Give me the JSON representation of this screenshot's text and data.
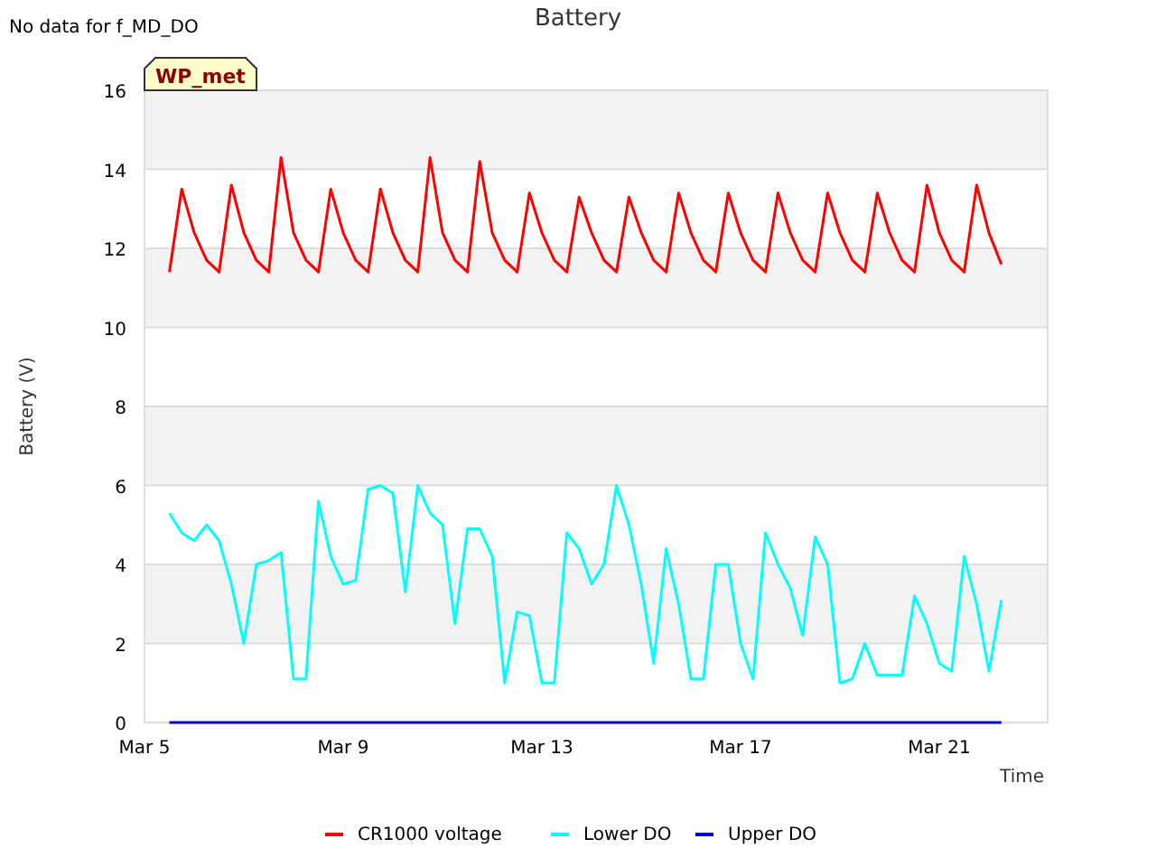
{
  "note": "No data for f_MD_DO",
  "tag": "WP_met",
  "chart_data": {
    "type": "line",
    "title": "Battery",
    "xlabel": "Time",
    "ylabel": "Battery (V)",
    "categories": [
      "Mar 5",
      null,
      null,
      null,
      null,
      null,
      null,
      null,
      null,
      null,
      null,
      null,
      null,
      null,
      null,
      null,
      "Mar 9",
      null,
      null,
      null,
      null,
      null,
      null,
      null,
      null,
      null,
      null,
      null,
      null,
      null,
      null,
      null,
      "Mar 13",
      null,
      null,
      null,
      null,
      null,
      null,
      null,
      null,
      null,
      null,
      null,
      null,
      null,
      null,
      null,
      "Mar 17",
      null,
      null,
      null,
      null,
      null,
      null,
      null,
      null,
      null,
      null,
      null,
      null,
      null,
      null,
      null,
      "Mar 21",
      null,
      null,
      null,
      null,
      null,
      null,
      null,
      null
    ],
    "series": [
      {
        "name": "CR1000 voltage",
        "color": "#ff0000",
        "values": [
          null,
          null,
          11.4,
          13.5,
          12.4,
          11.7,
          11.4,
          13.6,
          12.4,
          11.7,
          11.4,
          14.3,
          12.4,
          11.7,
          11.4,
          13.5,
          12.4,
          11.7,
          11.4,
          13.5,
          12.4,
          11.7,
          11.4,
          14.3,
          12.4,
          11.7,
          11.4,
          14.2,
          12.4,
          11.7,
          11.4,
          13.4,
          12.4,
          11.7,
          11.4,
          13.3,
          12.4,
          11.7,
          11.4,
          13.3,
          12.4,
          11.7,
          11.4,
          13.4,
          12.4,
          11.7,
          11.4,
          13.4,
          12.4,
          11.7,
          11.4,
          13.4,
          12.4,
          11.7,
          11.4,
          13.4,
          12.4,
          11.7,
          11.4,
          13.4,
          12.4,
          11.7,
          11.4,
          13.6,
          12.4,
          11.7,
          11.4,
          13.6,
          12.4,
          11.6,
          null,
          null,
          null
        ]
      },
      {
        "name": "Lower DO",
        "color": "#00ffff",
        "values": [
          null,
          null,
          5.3,
          4.8,
          4.6,
          5.0,
          4.6,
          3.5,
          2.0,
          4.0,
          4.1,
          4.3,
          1.1,
          1.1,
          5.6,
          4.2,
          3.5,
          3.6,
          5.9,
          6.0,
          5.8,
          3.3,
          6.0,
          5.3,
          5.0,
          2.5,
          4.9,
          4.9,
          4.2,
          1.0,
          2.8,
          2.7,
          1.0,
          1.0,
          4.8,
          4.4,
          3.5,
          4.0,
          6.0,
          5.0,
          3.5,
          1.5,
          4.4,
          3.0,
          1.1,
          1.1,
          4.0,
          4.0,
          2.0,
          1.1,
          4.8,
          4.0,
          3.4,
          2.2,
          4.7,
          4.0,
          1.0,
          1.1,
          2.0,
          1.2,
          1.2,
          1.2,
          3.2,
          2.5,
          1.5,
          1.3,
          4.2,
          3.0,
          1.3,
          3.1,
          null,
          null,
          null
        ]
      },
      {
        "name": "Upper DO",
        "color": "#0000cd",
        "values": [
          null,
          null,
          0,
          0,
          0,
          0,
          0,
          0,
          0,
          0,
          0,
          0,
          0,
          0,
          0,
          0,
          0,
          0,
          0,
          0,
          0,
          0,
          0,
          0,
          0,
          0,
          0,
          0,
          0,
          0,
          0,
          0,
          0,
          0,
          0,
          0,
          0,
          0,
          0,
          0,
          0,
          0,
          0,
          0,
          0,
          0,
          0,
          0,
          0,
          0,
          0,
          0,
          0,
          0,
          0,
          0,
          0,
          0,
          0,
          0,
          0,
          0,
          0,
          0,
          0,
          0,
          0,
          0,
          0,
          0,
          null,
          null,
          null
        ]
      }
    ],
    "ylim": [
      0,
      16
    ],
    "grid": true,
    "legend": "bottom",
    "yticks": [
      0,
      2,
      4,
      6,
      8,
      10,
      12,
      14,
      16
    ]
  }
}
